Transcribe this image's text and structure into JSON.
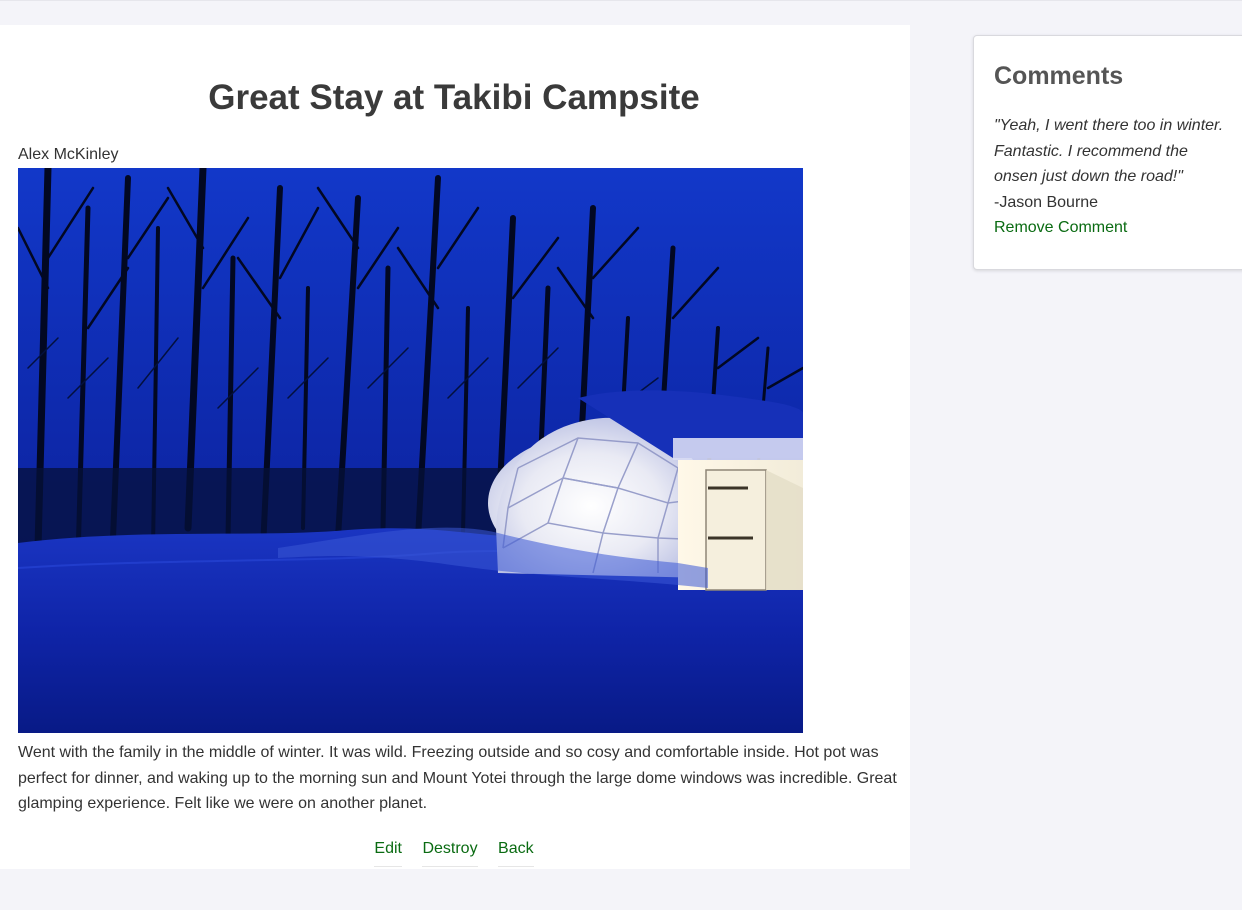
{
  "post": {
    "title": "Great Stay at Takibi Campsite",
    "author": "Alex McKinley",
    "photo_alt": "Glowing glamping dome tent in snowy forest at night",
    "body": "Went with the family in the middle of winter. It was wild. Freezing outside and so cosy and comfortable inside. Hot pot was perfect for dinner, and waking up to the morning sun and Mount Yotei through the large dome windows was incredible. Great glamping experience. Felt like we were on another planet.",
    "actions": {
      "edit_label": "Edit",
      "destroy_label": "Destroy",
      "back_label": "Back"
    }
  },
  "comments": {
    "heading": "Comments",
    "items": [
      {
        "text": "\"Yeah, I went there too in winter. Fantastic. I recommend the onsen just down the road!\"",
        "author": "-Jason Bourne",
        "remove_label": "Remove Comment"
      }
    ]
  },
  "colors": {
    "page_background": "#f4f4f9",
    "card_background": "#ffffff",
    "link_green": "#0a6b12",
    "text": "#333333",
    "heading": "#3a3a3a"
  }
}
